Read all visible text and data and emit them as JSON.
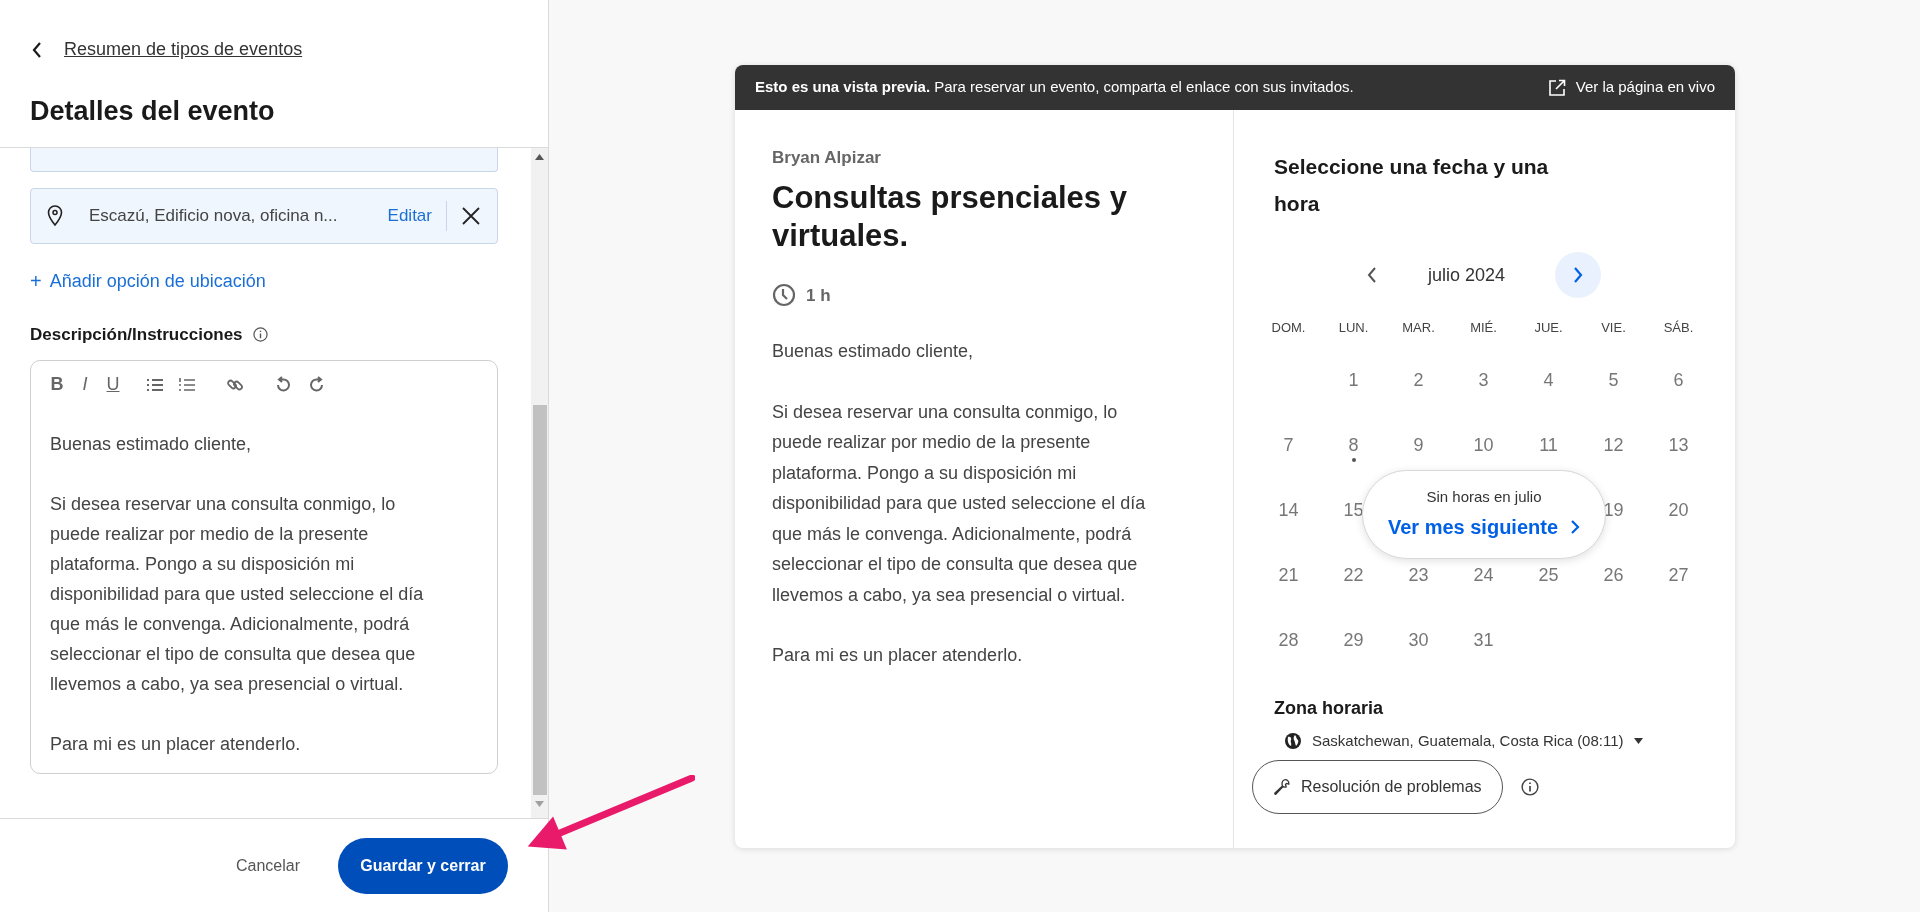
{
  "back_link": "Resumen de tipos de eventos",
  "title": "Detalles del evento",
  "location": {
    "text": "Escazú, Edificio nova, oficina n...",
    "edit": "Editar"
  },
  "add_location": {
    "icon": "+",
    "label": "Añadir opción de ubicación"
  },
  "description": {
    "label": "Descripción/Instrucciones",
    "format_buttons": [
      "B",
      "I",
      "U"
    ],
    "paragraphs": [
      "Buenas estimado cliente,",
      "Si desea reservar una consulta conmigo, lo puede realizar por medio de la presente plataforma. Pongo a su disposición mi disponibilidad para que usted seleccione el día que más le convenga. Adicionalmente, podrá seleccionar el tipo de consulta que desea que llevemos a cabo, ya sea presencial o virtual.",
      "Para mi es un placer atenderlo."
    ]
  },
  "footer": {
    "cancel": "Cancelar",
    "save": "Guardar y cerrar"
  },
  "preview": {
    "banner": "**Esto es una vista previa.** Para reservar un evento, comparta el enlace con sus invitados.",
    "live_link": "Ver la página en vivo",
    "host": "Bryan Alpizar",
    "event_title": "Consultas prsenciales y virtuales.",
    "duration": "1 h",
    "paragraphs": [
      "Buenas estimado cliente,",
      "Si desea reservar una consulta conmigo, lo puede realizar por medio de la presente plataforma. Pongo a su disposición mi disponibilidad para que usted seleccione el día que más le convenga. Adicionalmente, podrá seleccionar el tipo de consulta que desea que llevemos a cabo, ya sea presencial o virtual.",
      "Para mi es un placer atenderlo."
    ],
    "calendar": {
      "heading": "Seleccione una fecha y una hora",
      "month": "julio 2024",
      "weekdays": [
        "DOM.",
        "LUN.",
        "MAR.",
        "MIÉ.",
        "JUE.",
        "VIE.",
        "SÁB."
      ],
      "weeks": [
        {
          "right": [
            {
              "label": "1",
              "today": false
            },
            {
              "label": "2",
              "today": false
            },
            {
              "label": "3",
              "today": false
            },
            {
              "label": "4",
              "today": false
            },
            {
              "label": "5",
              "today": false
            },
            {
              "label": "6",
              "today": false
            }
          ]
        },
        {
          "left": [
            {
              "label": "7",
              "today": false
            },
            {
              "label": "8",
              "today": true
            },
            {
              "label": "9",
              "today": false
            },
            {
              "label": "10",
              "today": false
            },
            {
              "label": "11",
              "today": false
            },
            {
              "label": "12",
              "today": false
            },
            {
              "label": "13",
              "today": false
            }
          ]
        },
        {
          "left": [
            {
              "label": "14",
              "today": false
            },
            {
              "label": "15",
              "today": false
            }
          ],
          "right": [
            {
              "label": "19",
              "today": false
            },
            {
              "label": "20",
              "today": false
            }
          ]
        },
        {
          "left": [
            {
              "label": "21",
              "today": false
            },
            {
              "label": "22",
              "today": false
            },
            {
              "label": "23",
              "today": false
            },
            {
              "label": "24",
              "today": false
            },
            {
              "label": "25",
              "today": false
            },
            {
              "label": "26",
              "today": false
            },
            {
              "label": "27",
              "today": false
            }
          ]
        },
        {
          "left": [
            {
              "label": "28",
              "today": false
            },
            {
              "label": "29",
              "today": false
            },
            {
              "label": "30",
              "today": false
            },
            {
              "label": "31",
              "today": false
            }
          ]
        }
      ],
      "popup": {
        "note": "Sin horas en julio",
        "link": "Ver mes siguiente"
      }
    },
    "timezone": {
      "label": "Zona horaria",
      "value": "Saskatchewan, Guatemala, Costa Rica (08:11)"
    },
    "troubleshoot": "Resolución de problemas"
  }
}
